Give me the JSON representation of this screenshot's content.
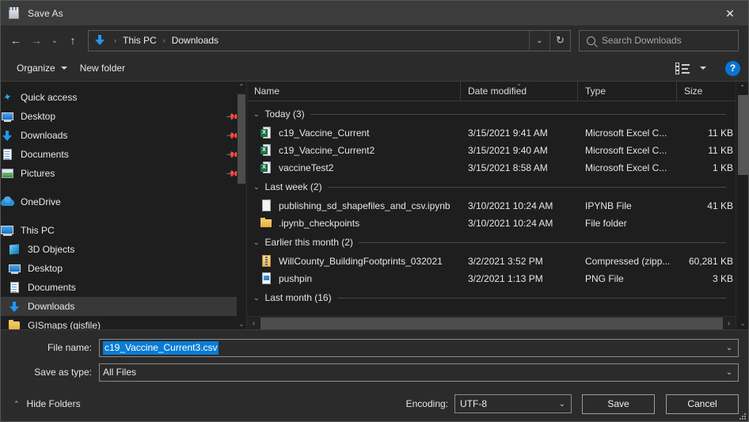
{
  "window": {
    "title": "Save As",
    "title_icon": "notepad-icon",
    "close_label": "✕"
  },
  "nav": {
    "back_label": "←",
    "forward_label": "→",
    "recent_label": "⌄",
    "up_label": "↑",
    "breadcrumb": [
      "This PC",
      "Downloads"
    ],
    "breadcrumb_sep": "›",
    "dropdown_label": "⌄",
    "refresh_label": "↻"
  },
  "search": {
    "placeholder": "Search Downloads",
    "icon": "search-icon"
  },
  "toolbar": {
    "organize_label": "Organize",
    "new_folder_label": "New folder",
    "view_icon": "list-view-icon",
    "view_caret": "▾",
    "help_label": "?"
  },
  "sidebar": {
    "groups": [
      {
        "header": {
          "label": "Quick access",
          "icon": "star-icon"
        },
        "items": [
          {
            "label": "Desktop",
            "icon": "monitor-icon",
            "pinned": true
          },
          {
            "label": "Downloads",
            "icon": "download-arrow-icon",
            "pinned": true
          },
          {
            "label": "Documents",
            "icon": "document-icon",
            "pinned": true
          },
          {
            "label": "Pictures",
            "icon": "picture-icon",
            "pinned": true
          }
        ]
      },
      {
        "header": {
          "label": "OneDrive",
          "icon": "cloud-icon"
        },
        "items": []
      },
      {
        "header": {
          "label": "This PC",
          "icon": "pc-icon"
        },
        "items": [
          {
            "label": "3D Objects",
            "icon": "cube-icon",
            "pinned": false
          },
          {
            "label": "Desktop",
            "icon": "monitor-icon",
            "pinned": false
          },
          {
            "label": "Documents",
            "icon": "document-icon",
            "pinned": false
          },
          {
            "label": "Downloads",
            "icon": "download-arrow-icon",
            "pinned": false,
            "selected": true
          },
          {
            "label": "GISmaps (gisfile)",
            "icon": "folder-icon",
            "pinned": false
          }
        ]
      }
    ],
    "pin_glyph": "✓"
  },
  "filelist": {
    "columns": [
      {
        "label": "Name",
        "sorted": false
      },
      {
        "label": "Date modified",
        "sorted": true
      },
      {
        "label": "Type",
        "sorted": false
      },
      {
        "label": "Size",
        "sorted": false
      }
    ],
    "sort_glyph": "⌄",
    "group_chevron": "⌄",
    "groups": [
      {
        "title": "Today (3)",
        "rows": [
          {
            "name": "c19_Vaccine_Current",
            "date": "3/15/2021 9:41 AM",
            "type": "Microsoft Excel C...",
            "size": "11 KB",
            "icon": "excel-csv-icon"
          },
          {
            "name": "c19_Vaccine_Current2",
            "date": "3/15/2021 9:40 AM",
            "type": "Microsoft Excel C...",
            "size": "11 KB",
            "icon": "excel-csv-icon"
          },
          {
            "name": "vaccineTest2",
            "date": "3/15/2021 8:58 AM",
            "type": "Microsoft Excel C...",
            "size": "1 KB",
            "icon": "excel-csv-icon"
          }
        ]
      },
      {
        "title": "Last week (2)",
        "rows": [
          {
            "name": "publishing_sd_shapefiles_and_csv.ipynb",
            "date": "3/10/2021 10:24 AM",
            "type": "IPYNB File",
            "size": "41 KB",
            "icon": "generic-file-icon"
          },
          {
            "name": ".ipynb_checkpoints",
            "date": "3/10/2021 10:24 AM",
            "type": "File folder",
            "size": "",
            "icon": "folder-icon"
          }
        ]
      },
      {
        "title": "Earlier this month (2)",
        "rows": [
          {
            "name": "WillCounty_BuildingFootprints_032021",
            "date": "3/2/2021 3:52 PM",
            "type": "Compressed (zipp...",
            "size": "60,281 KB",
            "icon": "zip-icon"
          },
          {
            "name": "pushpin",
            "date": "3/2/2021 1:13 PM",
            "type": "PNG File",
            "size": "3 KB",
            "icon": "png-icon"
          }
        ]
      },
      {
        "title": "Last month (16)",
        "rows": []
      }
    ],
    "scroll": {
      "up_glyph": "⌃",
      "down_glyph": "⌄",
      "left_glyph": "‹",
      "right_glyph": "›"
    }
  },
  "form": {
    "filename_label": "File name:",
    "filename_value": "c19_Vaccine_Current3.csv",
    "filename_selected": true,
    "savetype_label": "Save as type:",
    "savetype_value": "All Files",
    "caret_glyph": "⌄"
  },
  "footer": {
    "hide_folders_label": "Hide Folders",
    "hide_folders_chevron": "⌃",
    "encoding_label": "Encoding:",
    "encoding_value": "UTF-8",
    "encoding_caret": "⌄",
    "save_label": "Save",
    "cancel_label": "Cancel"
  },
  "colors": {
    "accent": "#0a7cd4",
    "selection": "#0a7cd4",
    "window_bg": "#2b2b2b",
    "pane_bg": "#1e1e1e",
    "row_selected": "#383838"
  }
}
